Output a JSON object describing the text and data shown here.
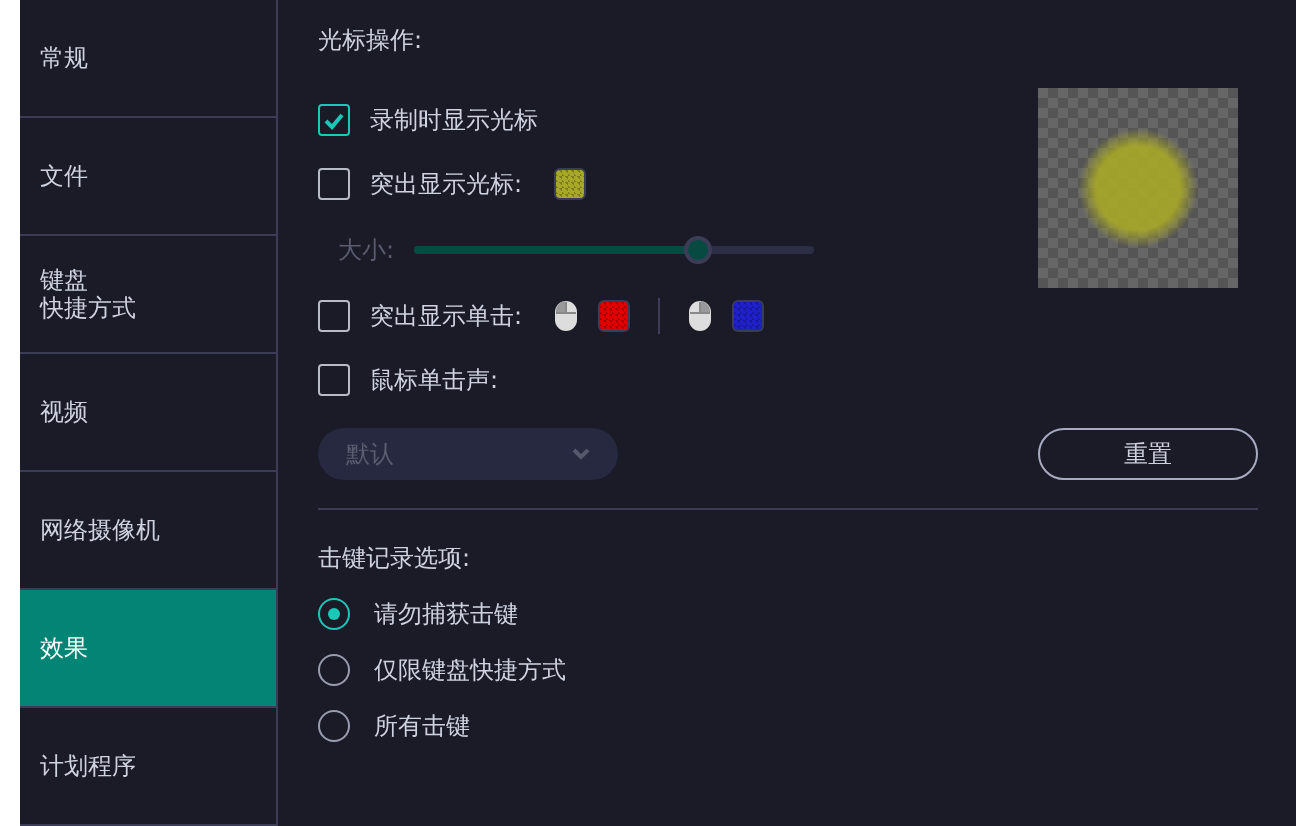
{
  "sidebar": {
    "items": [
      {
        "lines": [
          "常规"
        ],
        "selected": false
      },
      {
        "lines": [
          "文件"
        ],
        "selected": false
      },
      {
        "lines": [
          "键盘",
          "快捷方式"
        ],
        "selected": false
      },
      {
        "lines": [
          "视频"
        ],
        "selected": false
      },
      {
        "lines": [
          "网络摄像机"
        ],
        "selected": false
      },
      {
        "lines": [
          "效果"
        ],
        "selected": true
      },
      {
        "lines": [
          "计划程序"
        ],
        "selected": false
      }
    ]
  },
  "cursor_section": {
    "title": "光标操作:",
    "show_cursor": {
      "label": "录制时显示光标",
      "checked": true
    },
    "highlight_cursor": {
      "label": "突出显示光标:",
      "checked": false,
      "color": "#a8a828"
    },
    "size": {
      "label": "大小:",
      "level": 0.71,
      "disabled": true
    },
    "highlight_clicks": {
      "label": "突出显示单击:",
      "checked": false,
      "swatches": [
        {
          "kind": "left",
          "color": "#e00000"
        },
        {
          "kind": "right",
          "color": "#2020c8"
        }
      ]
    },
    "click_sound": {
      "label": "鼠标单击声:",
      "checked": false
    },
    "sound_dropdown": {
      "value": "默认",
      "disabled": true
    },
    "reset_button": "重置"
  },
  "keystroke_section": {
    "title": "击键记录选项:",
    "options": [
      {
        "label": "请勿捕获击键",
        "selected": true
      },
      {
        "label": "仅限键盘快捷方式",
        "selected": false
      },
      {
        "label": "所有击键",
        "selected": false
      }
    ]
  }
}
